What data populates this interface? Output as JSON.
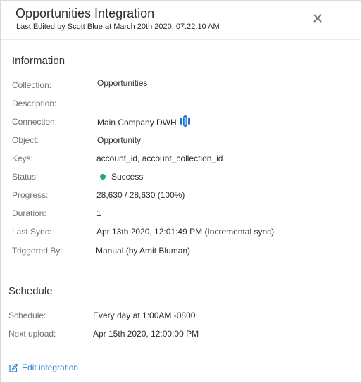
{
  "header": {
    "title": "Opportunities Integration",
    "subtitle": "Last Edited by Scott Blue at March 20th 2020, 07:22:10 AM",
    "close_icon": "close-icon"
  },
  "information": {
    "heading": "Information",
    "fields": {
      "collection": {
        "label": "Collection:",
        "value": "Opportunities"
      },
      "description": {
        "label": "Description:",
        "value": ""
      },
      "connection": {
        "label": "Connection:",
        "value": "Main Company DWH",
        "icon": "database-icon",
        "icon_color": "#1f6fd1"
      },
      "object": {
        "label": "Object:",
        "value": "Opportunity"
      },
      "keys": {
        "label": "Keys:",
        "value": "account_id, account_collection_id"
      },
      "status": {
        "label": "Status:",
        "value": "Success",
        "dot_color": "#2aa37f"
      },
      "progress": {
        "label": "Progress:",
        "value": "28,630 / 28,630 (100%)"
      },
      "duration": {
        "label": "Duration:",
        "value": "1"
      },
      "last_sync": {
        "label": "Last Sync:",
        "value": "Apr 13th 2020, 12:01:49 PM (Incremental sync)"
      },
      "triggered_by": {
        "label": "Triggered By:",
        "value": "Manual (by Amit Bluman)"
      }
    }
  },
  "schedule": {
    "heading": "Schedule",
    "fields": {
      "schedule": {
        "label": "Schedule:",
        "value": "Every day at 1:00AM -0800"
      },
      "next_upload": {
        "label": "Next upload:",
        "value": "Apr 15th 2020, 12:00:00 PM"
      }
    }
  },
  "footer": {
    "edit_label": "Edit integration",
    "edit_icon": "edit-icon",
    "link_color": "#2a7fd4"
  }
}
